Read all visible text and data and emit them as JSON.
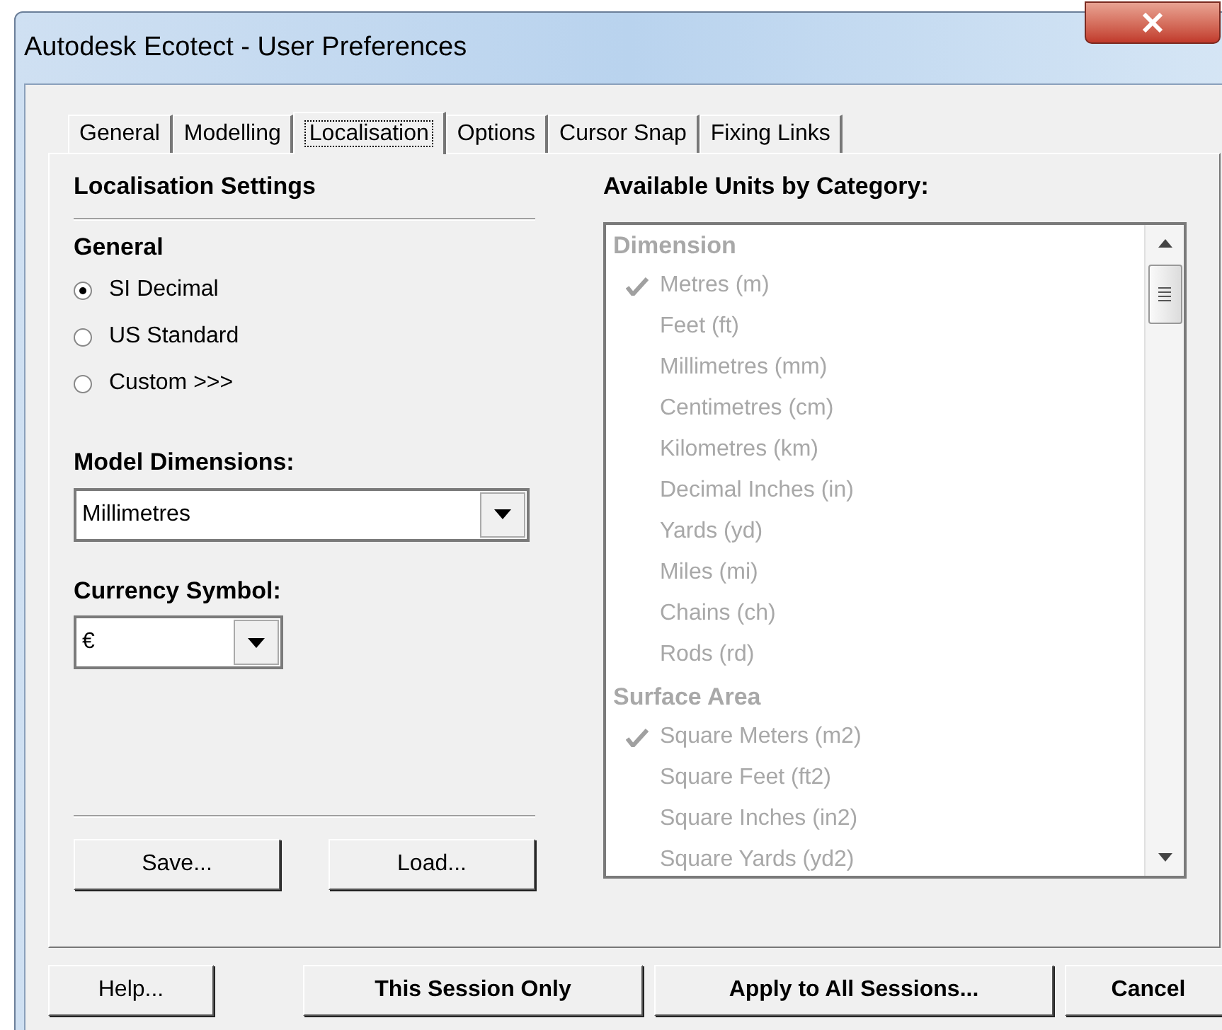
{
  "window": {
    "title": "Autodesk Ecotect - User Preferences"
  },
  "tabs": [
    {
      "label": "General",
      "selected": false
    },
    {
      "label": "Modelling",
      "selected": false
    },
    {
      "label": "Localisation",
      "selected": true
    },
    {
      "label": "Options",
      "selected": false
    },
    {
      "label": "Cursor Snap",
      "selected": false
    },
    {
      "label": "Fixing Links",
      "selected": false
    }
  ],
  "settings": {
    "heading": "Localisation Settings",
    "general_label": "General",
    "radios": [
      {
        "label": "SI Decimal",
        "selected": true
      },
      {
        "label": "US Standard",
        "selected": false
      },
      {
        "label": "Custom >>>",
        "selected": false
      }
    ],
    "model_dimensions": {
      "label": "Model Dimensions:",
      "value": "Millimetres"
    },
    "currency": {
      "label": "Currency Symbol:",
      "value": "€"
    },
    "buttons": [
      "Save...",
      "Load..."
    ]
  },
  "units": {
    "label": "Available Units by Category:",
    "disabled": true,
    "items": [
      {
        "kind": "category",
        "label": "Dimension"
      },
      {
        "kind": "unit",
        "label": "Metres (m)",
        "checked": true
      },
      {
        "kind": "unit",
        "label": "Feet (ft)",
        "checked": false
      },
      {
        "kind": "unit",
        "label": "Millimetres (mm)",
        "checked": false
      },
      {
        "kind": "unit",
        "label": "Centimetres (cm)",
        "checked": false
      },
      {
        "kind": "unit",
        "label": "Kilometres (km)",
        "checked": false
      },
      {
        "kind": "unit",
        "label": "Decimal Inches (in)",
        "checked": false
      },
      {
        "kind": "unit",
        "label": "Yards (yd)",
        "checked": false
      },
      {
        "kind": "unit",
        "label": "Miles (mi)",
        "checked": false
      },
      {
        "kind": "unit",
        "label": "Chains (ch)",
        "checked": false
      },
      {
        "kind": "unit",
        "label": "Rods (rd)",
        "checked": false
      },
      {
        "kind": "category",
        "label": "Surface Area"
      },
      {
        "kind": "unit",
        "label": "Square Meters (m2)",
        "checked": true
      },
      {
        "kind": "unit",
        "label": "Square Feet (ft2)",
        "checked": false
      },
      {
        "kind": "unit",
        "label": "Square Inches (in2)",
        "checked": false
      },
      {
        "kind": "unit",
        "label": "Square Yards (yd2)",
        "checked": false
      }
    ]
  },
  "footer_buttons": [
    {
      "label": "Help...",
      "bold": false
    },
    {
      "label": "This Session Only",
      "bold": true
    },
    {
      "label": "Apply to All Sessions...",
      "bold": true
    },
    {
      "label": "Cancel",
      "bold": true
    }
  ]
}
